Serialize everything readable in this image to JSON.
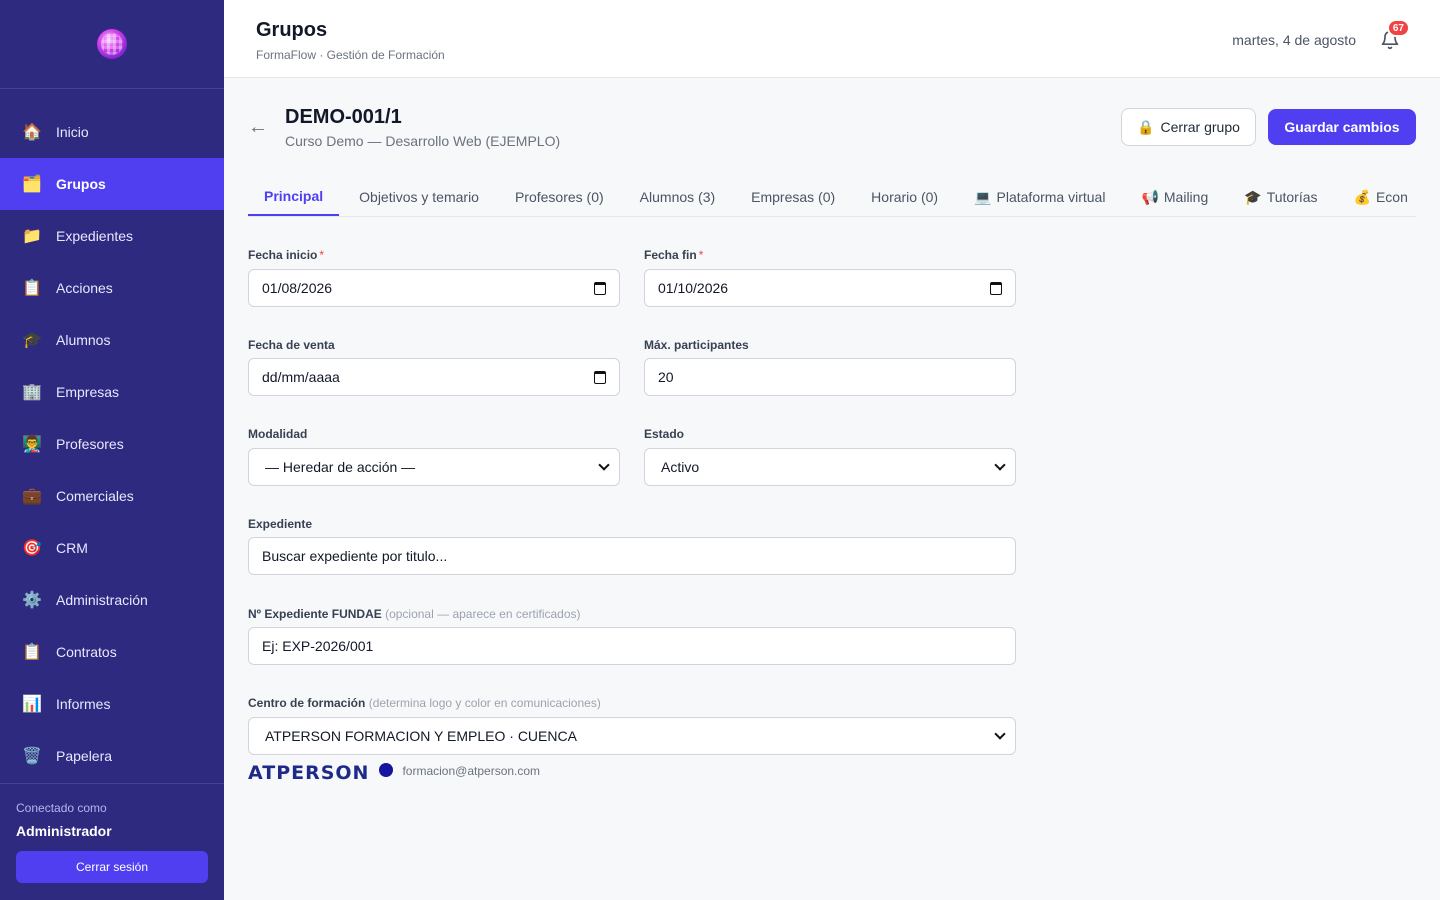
{
  "sidebar": {
    "items": [
      {
        "label": "Inicio",
        "icon": "🏠"
      },
      {
        "label": "Grupos",
        "icon": "🗂️"
      },
      {
        "label": "Expedientes",
        "icon": "📁"
      },
      {
        "label": "Acciones",
        "icon": "📋"
      },
      {
        "label": "Alumnos",
        "icon": "🎓"
      },
      {
        "label": "Empresas",
        "icon": "🏢"
      },
      {
        "label": "Profesores",
        "icon": "👨‍🏫"
      },
      {
        "label": "Comerciales",
        "icon": "💼"
      },
      {
        "label": "CRM",
        "icon": "🎯"
      },
      {
        "label": "Administración",
        "icon": "⚙️"
      },
      {
        "label": "Contratos",
        "icon": "📋"
      },
      {
        "label": "Informes",
        "icon": "📊"
      },
      {
        "label": "Papelera",
        "icon": "🗑️"
      }
    ],
    "connected_label": "Conectado como",
    "user": "Administrador",
    "logout": "Cerrar sesión"
  },
  "header": {
    "title": "Grupos",
    "subtitle": "FormaFlow · Gestión de Formación",
    "date": "martes, 4 de agosto",
    "notifications": "67"
  },
  "group": {
    "code": "DEMO-001/1",
    "course": "Curso Demo — Desarrollo Web (EJEMPLO)",
    "close_button": "Cerrar grupo",
    "save_button": "Guardar cambios"
  },
  "tabs": [
    {
      "label": "Principal",
      "icon": ""
    },
    {
      "label": "Objetivos y temario",
      "icon": ""
    },
    {
      "label": "Profesores (0)",
      "icon": ""
    },
    {
      "label": "Alumnos (3)",
      "icon": ""
    },
    {
      "label": "Empresas (0)",
      "icon": ""
    },
    {
      "label": "Horario (0)",
      "icon": ""
    },
    {
      "label": "Plataforma virtual",
      "icon": "💻"
    },
    {
      "label": "Mailing",
      "icon": "📢"
    },
    {
      "label": "Tutorías",
      "icon": "🎓"
    },
    {
      "label": "Econ",
      "icon": "💰"
    }
  ],
  "form": {
    "fecha_inicio": {
      "label": "Fecha inicio",
      "value": "01/08/2026",
      "required": "*"
    },
    "fecha_fin": {
      "label": "Fecha fin",
      "value": "01/10/2026",
      "required": "*"
    },
    "fecha_venta": {
      "label": "Fecha de venta",
      "value": "dd/mm/aaaa"
    },
    "max_participantes": {
      "label": "Máx. participantes",
      "value": "20"
    },
    "modalidad": {
      "label": "Modalidad",
      "value": "— Heredar de acción —"
    },
    "estado": {
      "label": "Estado",
      "value": "Activo"
    },
    "expediente": {
      "label": "Expediente",
      "placeholder": "Buscar expediente por titulo..."
    },
    "fundae": {
      "label": "Nº Expediente FUNDAE",
      "hint": "(opcional — aparece en certificados)",
      "placeholder": "Ej: EXP-2026/001"
    },
    "centro": {
      "label": "Centro de formación",
      "hint": "(determina logo y color en comunicaciones)",
      "value": "ATPERSON FORMACION Y EMPLEO · CUENCA"
    }
  },
  "brand": {
    "logo_text": "ATPERSON",
    "email": "formacion@atperson.com"
  },
  "colors": {
    "sidebar_bg": "#2e2a80",
    "accent": "#4f3ff0",
    "badge": "#ef4444"
  }
}
